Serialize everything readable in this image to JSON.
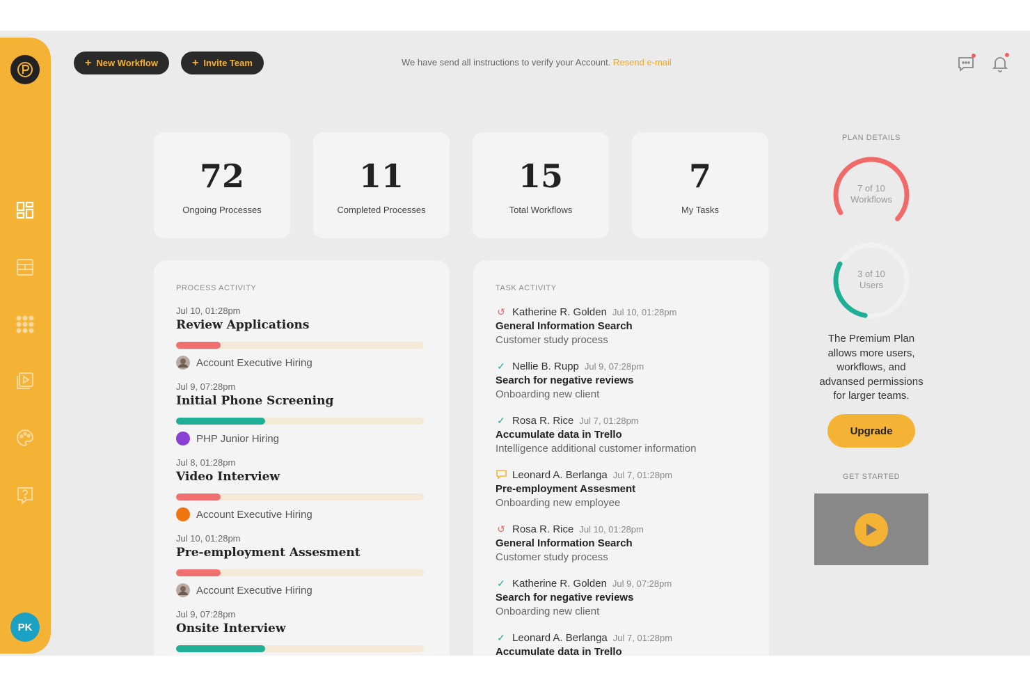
{
  "sidebar": {
    "logo_icon": "p-logo-icon",
    "items": [
      {
        "name": "dashboard",
        "icon": "dashboard-icon"
      },
      {
        "name": "processes",
        "icon": "board-icon"
      },
      {
        "name": "apps",
        "icon": "grid-icon"
      },
      {
        "name": "media",
        "icon": "play-library-icon"
      },
      {
        "name": "theme",
        "icon": "palette-icon"
      },
      {
        "name": "help",
        "icon": "help-icon"
      }
    ],
    "avatar_initials": "PK",
    "color": "#f5b335"
  },
  "topbar": {
    "new_workflow": "New Workflow",
    "invite_team": "Invite Team",
    "notice": "We have send all instructions to verify your Account.",
    "notice_link": "Resend e-mail"
  },
  "stats": [
    {
      "value": "72",
      "label": "Ongoing Processes"
    },
    {
      "value": "11",
      "label": "Completed Processes"
    },
    {
      "value": "15",
      "label": "Total Workflows"
    },
    {
      "value": "7",
      "label": "My Tasks"
    }
  ],
  "process_activity": {
    "title": "PROCESS ACTIVITY",
    "items": [
      {
        "date": "Jul 10, 01:28pm",
        "title": "Review Applications",
        "progress": 0.18,
        "bar_color": "#f07070",
        "tag": "Account Executive Hiring",
        "tag_kind": "photo"
      },
      {
        "date": "Jul 9, 07:28pm",
        "title": "Initial Phone Screening",
        "progress": 0.36,
        "bar_color": "#1fae96",
        "tag": "PHP Junior Hiring",
        "tag_color": "#8a3fd6"
      },
      {
        "date": "Jul 8, 01:28pm",
        "title": "Video Interview",
        "progress": 0.18,
        "bar_color": "#f07070",
        "tag": "Account Executive Hiring",
        "tag_color": "#f0750f"
      },
      {
        "date": "Jul 10, 01:28pm",
        "title": "Pre-employment Assesment",
        "progress": 0.18,
        "bar_color": "#f07070",
        "tag": "Account Executive Hiring",
        "tag_kind": "photo"
      },
      {
        "date": "Jul 9, 07:28pm",
        "title": "Onsite Interview",
        "progress": 0.36,
        "bar_color": "#1fae96",
        "tag": ""
      }
    ]
  },
  "task_activity": {
    "title": "TASK ACTIVITY",
    "items": [
      {
        "icon": "redo-icon",
        "name": "Katherine R. Golden",
        "time": "Jul 10, 01:28pm",
        "title": "General Information Search",
        "sub": "Customer study process"
      },
      {
        "icon": "check-icon",
        "name": "Nellie B. Rupp",
        "time": "Jul 9, 07:28pm",
        "title": "Search for negative reviews",
        "sub": "Onboarding new client"
      },
      {
        "icon": "check-icon",
        "name": "Rosa R. Rice",
        "time": "Jul 7, 01:28pm",
        "title": "Accumulate data in Trello",
        "sub": "Intelligence additional customer information"
      },
      {
        "icon": "comment-icon",
        "name": "Leonard A. Berlanga",
        "time": "Jul 7, 01:28pm",
        "title": "Pre-employment Assesment",
        "sub": "Onboarding new employee"
      },
      {
        "icon": "redo-icon",
        "name": "Rosa R. Rice",
        "time": "Jul 10, 01:28pm",
        "title": "General Information Search",
        "sub": "Customer study process"
      },
      {
        "icon": "check-icon",
        "name": "Katherine R. Golden",
        "time": "Jul 9, 07:28pm",
        "title": "Search for negative reviews",
        "sub": "Onboarding new client"
      },
      {
        "icon": "check-icon",
        "name": "Leonard A. Berlanga",
        "time": "Jul 7, 01:28pm",
        "title": "Accumulate data in Trello",
        "sub": ""
      }
    ]
  },
  "plan": {
    "title": "PLAN DETAILS",
    "workflows_line1": "7 of 10",
    "workflows_line2": "Workflows",
    "workflows_fraction": 0.7,
    "workflows_color": "#f06a6a",
    "users_line1": "3 of 10",
    "users_line2": "Users",
    "users_fraction": 0.3,
    "users_color": "#1fae96",
    "description": "The Premium Plan allows more users, workflows, and advansed permissions for larger teams.",
    "upgrade": "Upgrade",
    "get_started": "GET STARTED"
  }
}
